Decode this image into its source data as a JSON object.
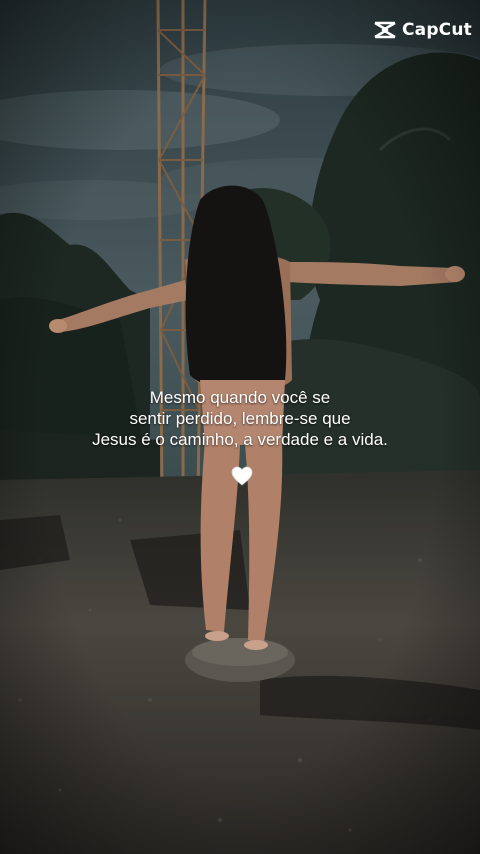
{
  "watermark": {
    "text": "CapCut",
    "icon": "capcut-logo-icon"
  },
  "caption": {
    "lines": [
      "Mesmo quando você se",
      "sentir perdido, lembre-se que",
      "Jesus é o caminho, a verdade e a vida."
    ],
    "emoji": "🤍",
    "emoji_icon": "white-heart-icon"
  },
  "colors": {
    "sky": "#3a4a50",
    "foliage": "#1f2b24",
    "ground": "#3d3a34",
    "text": "#ffffff"
  }
}
